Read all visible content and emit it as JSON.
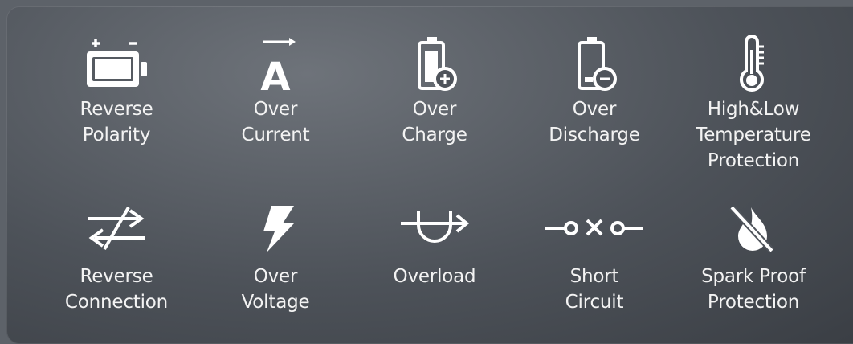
{
  "row1": [
    {
      "icon": "battery-polarity-icon",
      "lines": [
        "Reverse",
        "Polarity"
      ]
    },
    {
      "icon": "ampere-current-icon",
      "lines": [
        "Over",
        "Current"
      ]
    },
    {
      "icon": "battery-plus-icon",
      "lines": [
        "Over",
        "Charge"
      ]
    },
    {
      "icon": "battery-minus-icon",
      "lines": [
        "Over",
        "Discharge"
      ]
    },
    {
      "icon": "thermometer-icon",
      "lines": [
        "High&Low",
        "Temperature",
        "Protection"
      ]
    }
  ],
  "row2": [
    {
      "icon": "reverse-arrows-icon",
      "lines": [
        "Reverse",
        "Connection"
      ]
    },
    {
      "icon": "lightning-bolt-icon",
      "lines": [
        "Over",
        "Voltage"
      ]
    },
    {
      "icon": "overload-arrow-icon",
      "lines": [
        "Overload"
      ]
    },
    {
      "icon": "short-circuit-icon",
      "lines": [
        "Short",
        "Circuit"
      ]
    },
    {
      "icon": "no-fire-icon",
      "lines": [
        "Spark Proof",
        "Protection"
      ]
    }
  ],
  "colors": {
    "icon": "#ffffff",
    "text": "#f3f3f3"
  }
}
